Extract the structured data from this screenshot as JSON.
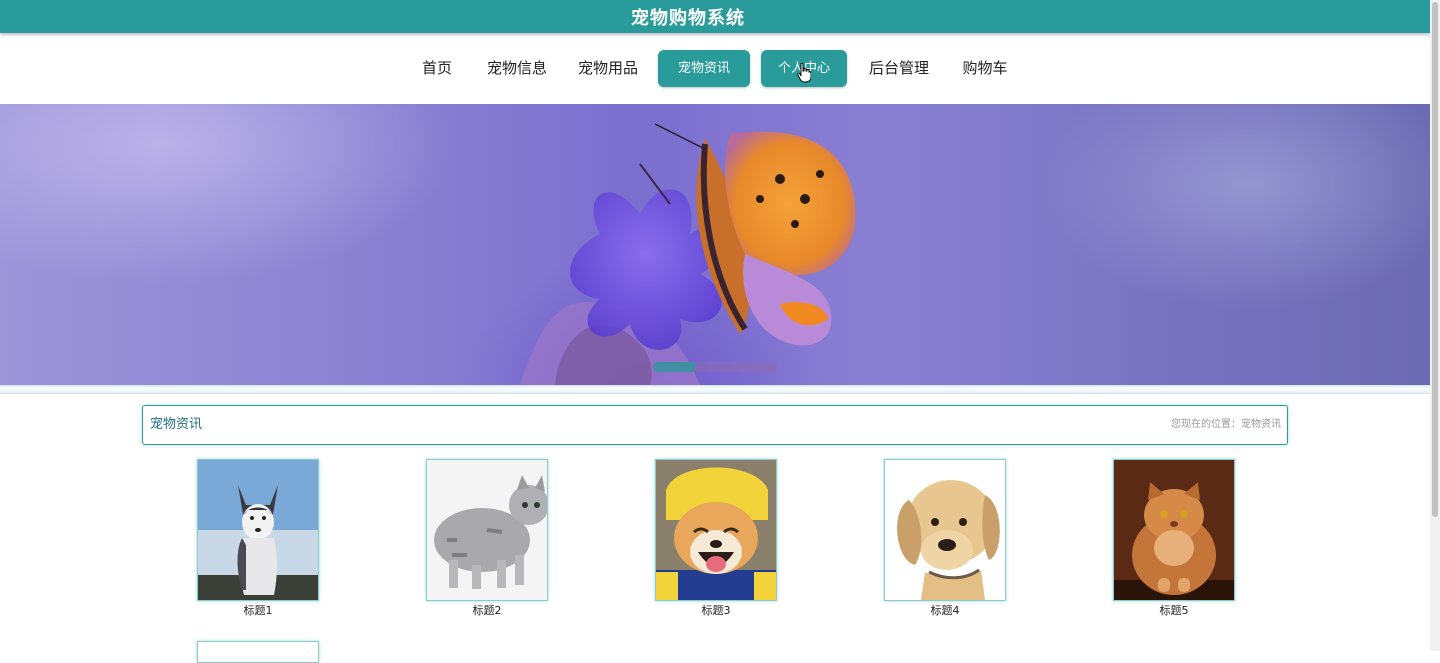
{
  "header": {
    "title": "宠物购物系统"
  },
  "nav": {
    "items": [
      {
        "label": "首页"
      },
      {
        "label": "宠物信息"
      },
      {
        "label": "宠物用品"
      },
      {
        "label": "宠物资讯"
      },
      {
        "label": "个人中心"
      },
      {
        "label": "后台管理"
      },
      {
        "label": "购物车"
      }
    ]
  },
  "section": {
    "title": "宠物资讯",
    "location": "您现在的位置：宠物资讯"
  },
  "news": [
    {
      "title": "标题1"
    },
    {
      "title": "标题2"
    },
    {
      "title": "标题3"
    },
    {
      "title": "标题4"
    },
    {
      "title": "标题5"
    }
  ],
  "colors": {
    "accent": "#2a9b9b"
  }
}
